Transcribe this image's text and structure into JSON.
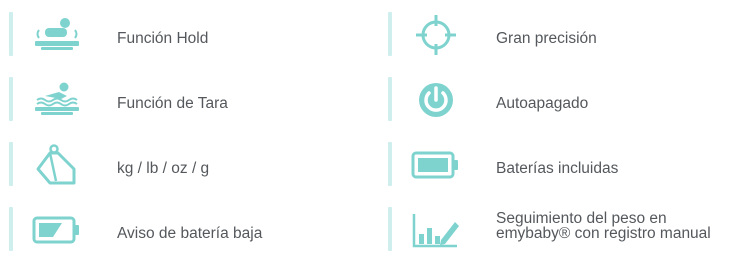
{
  "features": [
    {
      "label": "Función Hold",
      "icon": "baby-on-scale-icon"
    },
    {
      "label": "Gran precisión",
      "icon": "crosshair-icon"
    },
    {
      "label": "Función de Tara",
      "icon": "swimming-baby-on-scale-icon"
    },
    {
      "label": "Autoapagado",
      "icon": "power-icon"
    },
    {
      "label": "kg / lb / oz / g",
      "icon": "weight-icon"
    },
    {
      "label": "Baterías incluidas",
      "icon": "full-battery-icon"
    },
    {
      "label": "Aviso de batería baja",
      "icon": "low-battery-icon"
    },
    {
      "label_line1": "Seguimiento del peso en",
      "label_line2": "emybaby® con registro manual",
      "icon": "chart-pencil-icon"
    }
  ],
  "colors": {
    "accent": "#7fd3cf",
    "accent_light": "#cfeeee",
    "text": "#54585c"
  }
}
